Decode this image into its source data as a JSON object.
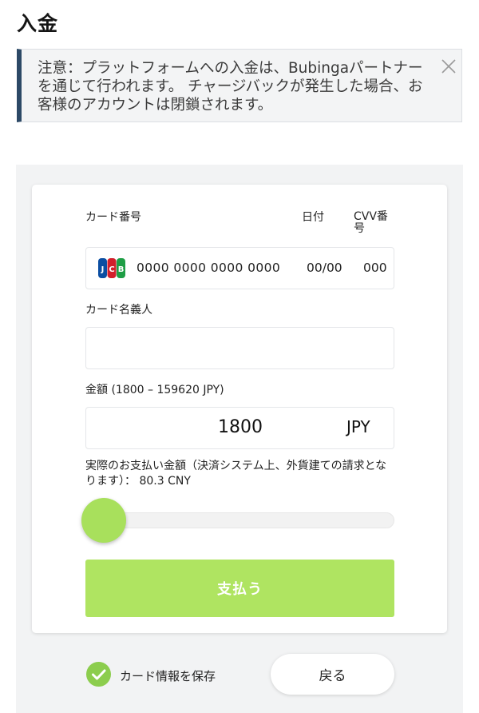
{
  "page": {
    "title": "入金"
  },
  "notice": {
    "text": "注意：プラットフォームへの入金は、Bubingaパートナーを通じて行われます。 チャージバックが発生した場合、お客様のアカウントは閉鎖されます。",
    "close_icon": "close-icon"
  },
  "card_form": {
    "card_number_label": "カード番号",
    "date_label": "日付",
    "cvv_label": "CVV番号",
    "card_brand_icon": "jcb-logo-icon",
    "card_number_placeholder": "0000 0000 0000 0000",
    "date_placeholder": "00/00",
    "cvv_placeholder": "000",
    "holder_label": "カード名義人",
    "holder_value": ""
  },
  "amount": {
    "label": "金額 (1800 – 159620 JPY)",
    "value": "1800",
    "currency": "JPY",
    "actual_label": "実際のお支払い金額（決済システム上、外貨建ての請求となります）： 80.3 CNY",
    "slider_fraction": 0.0
  },
  "actions": {
    "pay_label": "支払う",
    "save_label": "カード情報を保存",
    "save_checked": true,
    "back_label": "戻る"
  },
  "colors": {
    "accent_green": "#afe461",
    "notice_border": "#2c4966",
    "check_green": "#8ccd4d"
  }
}
